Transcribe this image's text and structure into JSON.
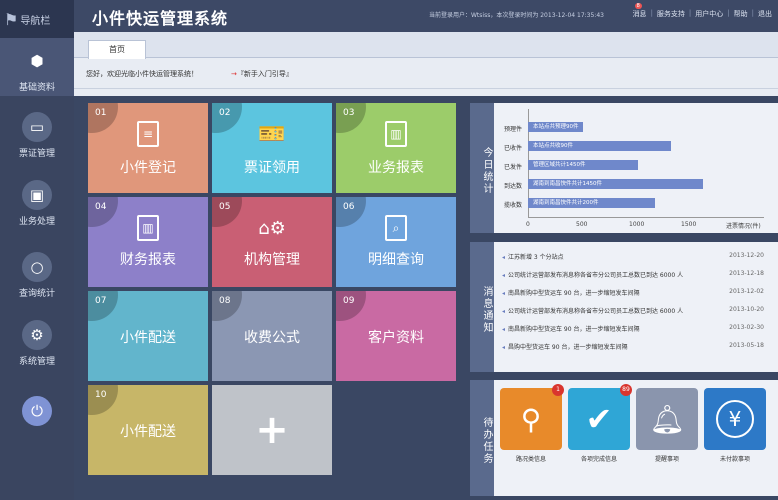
{
  "app": {
    "title": "小件快运管理系统",
    "login_info": "当前登录用户：Wtsiss，本次登录时间为   2013-12-04 17:35:43",
    "links": [
      "消息",
      "服务支持",
      "用户中心",
      "帮助",
      "退出"
    ],
    "message_count": "8"
  },
  "sidebar": {
    "nav_label": "导航栏",
    "items": [
      {
        "label": "基础资料",
        "icon": "cube-icon"
      },
      {
        "label": "票证管理",
        "icon": "folder-icon"
      },
      {
        "label": "业务处理",
        "icon": "monitor-icon"
      },
      {
        "label": "查询统计",
        "icon": "search-icon"
      },
      {
        "label": "系统管理",
        "icon": "gear-icon"
      }
    ],
    "power_icon": "power-icon"
  },
  "tabs": [
    {
      "label": "首页"
    }
  ],
  "welcome": "您好，欢迎光临小件快运管理系统！",
  "guide": "『新手入门引导』",
  "tiles": [
    {
      "num": "01",
      "label": "小件登记",
      "color": "#e0977b"
    },
    {
      "num": "02",
      "label": "票证领用",
      "color": "#5cc5df"
    },
    {
      "num": "03",
      "label": "业务报表",
      "color": "#9ccc6a"
    },
    {
      "num": "04",
      "label": "财务报表",
      "color": "#8d80c9"
    },
    {
      "num": "05",
      "label": "机构管理",
      "color": "#c95f74"
    },
    {
      "num": "06",
      "label": "明细查询",
      "color": "#6fa4dd"
    },
    {
      "num": "07",
      "label": "小件配送",
      "color": "#62b5cc"
    },
    {
      "num": "08",
      "label": "收费公式",
      "color": "#8b97b3"
    },
    {
      "num": "09",
      "label": "客户资料",
      "color": "#c96aa3"
    },
    {
      "num": "10",
      "label": "小件配送",
      "color": "#c7b668"
    }
  ],
  "stats": {
    "side_label": "今日统计",
    "axis_label": "进票情况(件)",
    "ticks": [
      "0",
      "500",
      "1000",
      "1500"
    ],
    "rows": [
      {
        "category": "预理件",
        "text": "本站点共预理90件",
        "value": 530
      },
      {
        "category": "已收件",
        "text": "本站点共收90件",
        "value": 1370
      },
      {
        "category": "已发件",
        "text": "管理区域共计1450件",
        "value": 1050
      },
      {
        "category": "到达数",
        "text": "湖南到南昌快件共计1450件",
        "value": 1680
      },
      {
        "category": "揽收数",
        "text": "湖南到南昌快件共计200件",
        "value": 1220
      }
    ]
  },
  "news": {
    "side_label": "消息通知",
    "items": [
      {
        "text": "江苏新增 3 个分站点",
        "date": "2013-12-20"
      },
      {
        "text": "公司统计运营部发布消息称各省市分公司员工总数已到达 6000 人",
        "date": "2013-12-18"
      },
      {
        "text": "南昌新购中型货运车 90 台，进一步缩短发车间隔",
        "date": "2013-12-02"
      },
      {
        "text": "公司统计运营部发布消息称各省市分公司员工总数已到达 6000 人",
        "date": "2013-10-20"
      },
      {
        "text": "南昌新购中型货运车 90 台，进一步缩短发车间隔",
        "date": "2013-02-30"
      },
      {
        "text": "昌购中型货运车 90 台，进一步缩短发车间隔",
        "date": "2013-05-18"
      }
    ]
  },
  "tasks": {
    "side_label": "待办任务",
    "items": [
      {
        "label": "路况类信息",
        "count": "1",
        "color": "#e88a2a",
        "icon": "location-pin-icon"
      },
      {
        "label": "各项完成信息",
        "count": "89",
        "color": "#2fa6d6",
        "icon": "check-icon"
      },
      {
        "label": "提醒事项",
        "count": "",
        "color": "#8a95ad",
        "icon": "bell-icon"
      },
      {
        "label": "未付款事项",
        "count": "",
        "color": "#2d79c7",
        "icon": "yen-icon"
      }
    ]
  }
}
